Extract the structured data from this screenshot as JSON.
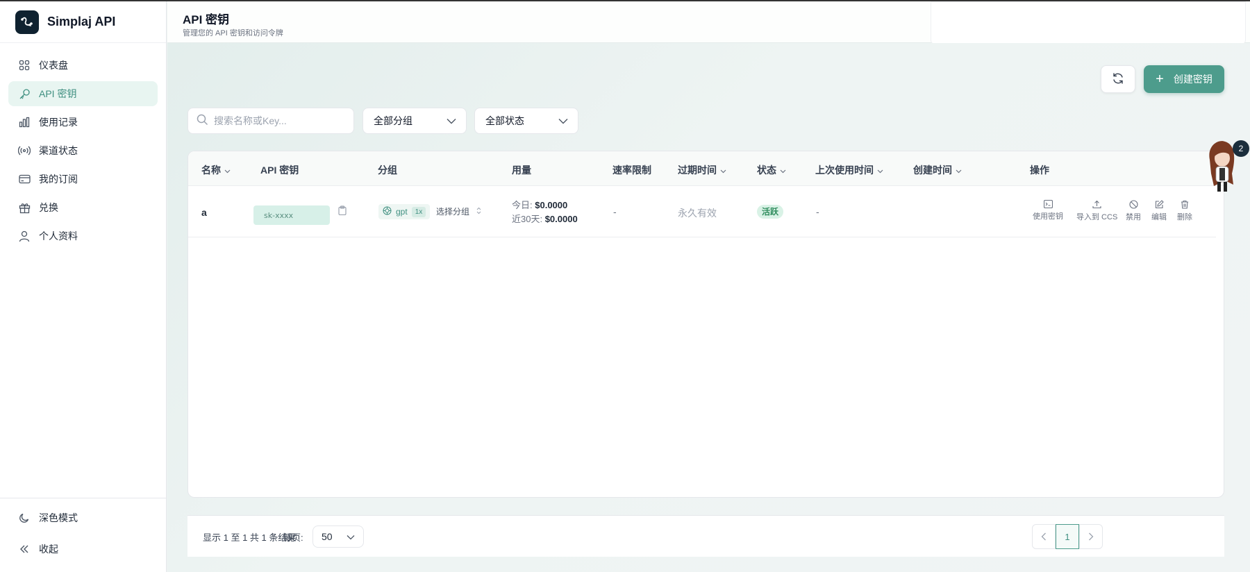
{
  "brand": {
    "name": "Simplaj API"
  },
  "sidebar": {
    "items": [
      {
        "label": "仪表盘",
        "icon": "dashboard-icon"
      },
      {
        "label": "API 密钥",
        "icon": "key-icon",
        "active": true
      },
      {
        "label": "使用记录",
        "icon": "chart-icon"
      },
      {
        "label": "渠道状态",
        "icon": "signal-icon"
      },
      {
        "label": "我的订阅",
        "icon": "card-icon"
      },
      {
        "label": "兑换",
        "icon": "gift-icon"
      },
      {
        "label": "个人资料",
        "icon": "user-icon"
      }
    ],
    "bottom": [
      {
        "label": "深色模式",
        "icon": "moon-icon"
      },
      {
        "label": "收起",
        "icon": "collapse-icon"
      }
    ]
  },
  "header": {
    "title": "API 密钥",
    "subtitle": "管理您的 API 密钥和访问令牌"
  },
  "toolbar": {
    "create_label": "创建密钥",
    "search_placeholder": "搜索名称或Key...",
    "group_filter": "全部分组",
    "status_filter": "全部状态"
  },
  "table": {
    "columns": [
      "名称",
      "API 密钥",
      "分组",
      "用量",
      "速率限制",
      "过期时间",
      "状态",
      "上次使用时间",
      "创建时间",
      "操作"
    ],
    "rows": [
      {
        "name": "a",
        "key": "sk-xxxx",
        "group": "gpt",
        "multiplier": "1x",
        "select_group": "选择分组",
        "usage_today_label": "今日:",
        "usage_today": "$0.0000",
        "usage_30d_label": "近30天:",
        "usage_30d": "$0.0000",
        "rate_limit": "-",
        "expires": "永久有效",
        "status": "活跃",
        "last_used": "-",
        "created": "",
        "actions": [
          "使用密钥",
          "导入到 CCS",
          "禁用",
          "编辑",
          "删除"
        ]
      }
    ]
  },
  "footer": {
    "summary": "显示 1 至 1 共 1 条结果",
    "per_page_label": "每页:",
    "per_page": "50",
    "current_page": "1"
  },
  "notification_count": "2",
  "colors": {
    "accent": "#4d9c8c",
    "active_bg": "#e8f5f1",
    "status_active": "#2f8c5d"
  }
}
